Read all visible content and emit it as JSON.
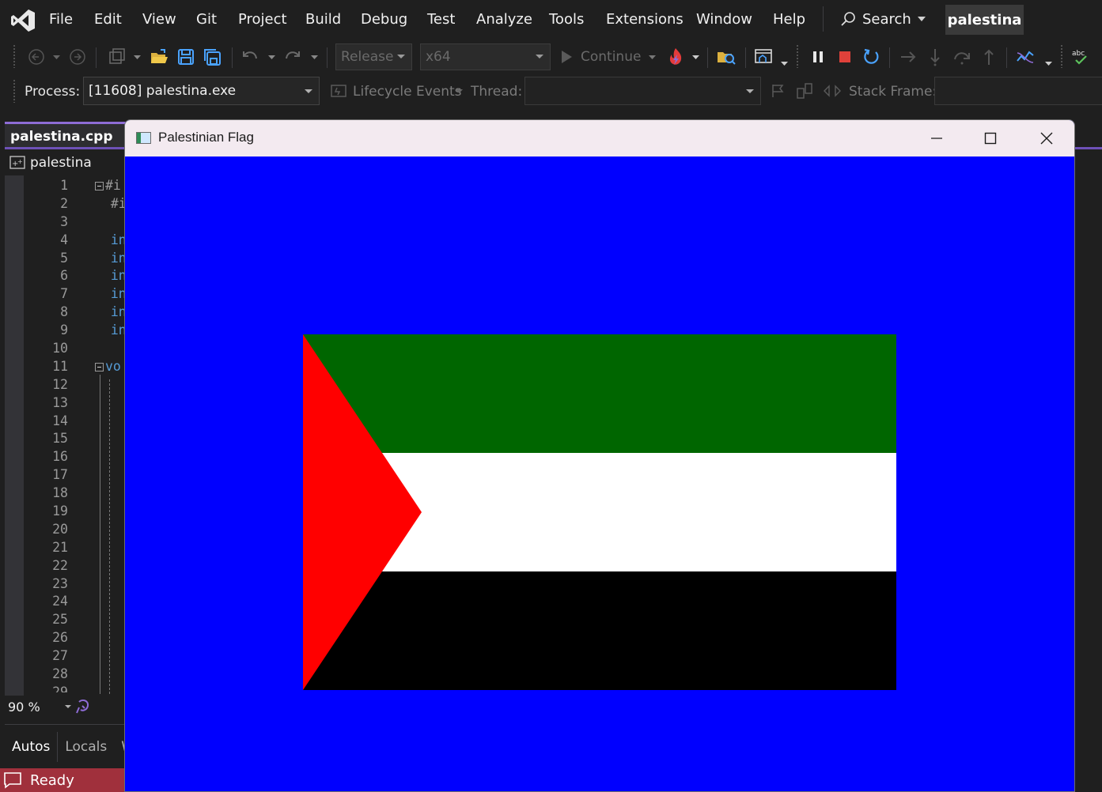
{
  "menubar": {
    "items": [
      "File",
      "Edit",
      "View",
      "Git",
      "Project",
      "Build",
      "Debug",
      "Test",
      "Analyze",
      "Tools",
      "Extensions",
      "Window",
      "Help"
    ],
    "search_label": "Search",
    "solution_name": "palestina"
  },
  "toolbar": {
    "configuration": "Release",
    "platform": "x64",
    "continue_label": "Continue"
  },
  "debugbar": {
    "process_label": "Process:",
    "process_value": "[11608] palestina.exe",
    "lifecycle_label": "Lifecycle Events",
    "thread_label": "Thread:",
    "stack_frame_label": "Stack Frame:"
  },
  "editor": {
    "tab_title": "palestina.cpp",
    "nav_project": "palestina",
    "line_numbers": [
      "1",
      "2",
      "3",
      "4",
      "5",
      "6",
      "7",
      "8",
      "9",
      "10",
      "11",
      "12",
      "13",
      "14",
      "15",
      "16",
      "17",
      "18",
      "19",
      "20",
      "21",
      "22",
      "23",
      "24",
      "25",
      "26",
      "27",
      "28",
      "29"
    ],
    "code_fragments": {
      "l1": "#i",
      "l2": "#i",
      "l4": "in",
      "l5": "in",
      "l6": "in",
      "l7": "in",
      "l8": "in",
      "l9": "in",
      "l11": "vo"
    },
    "zoom": "90 %",
    "bottom_tabs": [
      "Autos",
      "Locals",
      "W"
    ],
    "status": "Ready"
  },
  "app_window": {
    "title": "Palestinian Flag",
    "background_color": "#0000ff",
    "flag": {
      "stripe_colors": [
        "#006600",
        "#ffffff",
        "#000000"
      ],
      "triangle_color": "#ff0000"
    }
  }
}
